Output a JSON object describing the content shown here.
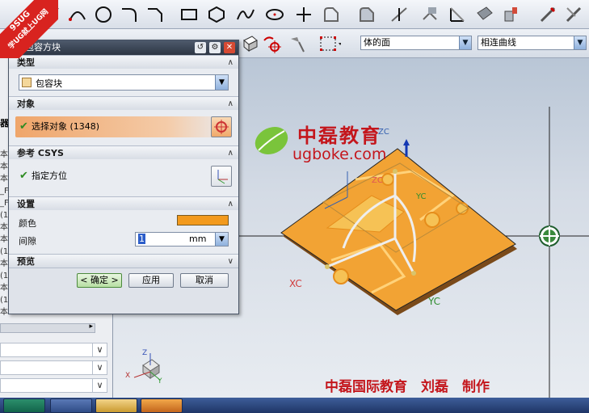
{
  "corner_badge": {
    "line1": "9SUG",
    "line2": "学UG就上UG网"
  },
  "toolbar2": {
    "combo1_value": "体的面",
    "combo2_value": "相连曲线"
  },
  "dialog": {
    "title": "包容方块",
    "sections": {
      "type": {
        "header": "类型",
        "value": "包容块"
      },
      "object": {
        "header": "对象",
        "select_label": "选择对象 (1348)"
      },
      "csys": {
        "header": "参考 CSYS",
        "orient_label": "指定方位"
      },
      "settings": {
        "header": "设置",
        "color_label": "颜色",
        "gap_label": "间隙",
        "gap_value": "1",
        "gap_unit": "mm"
      },
      "preview": {
        "header": "预览"
      }
    },
    "buttons": {
      "ok": "< 确定 >",
      "apply": "应用",
      "cancel": "取消"
    },
    "colors": {
      "swatch": "#f39a1d"
    }
  },
  "left_panel": {
    "header": "器",
    "rows": [
      "本",
      "本",
      "本",
      "_F_",
      "_F_",
      "(1)",
      "本",
      "本",
      "(1)",
      "本",
      "(1)",
      "本",
      "(1)",
      "本"
    ]
  },
  "viewport": {
    "brand_cn": "中磊教育",
    "brand_url": "ugboke.com",
    "credit": "中磊国际教育　刘磊　制作",
    "axis_labels": {
      "xc": "XC",
      "yc_small": "YC",
      "yc": "YC",
      "zc": "ZC",
      "zc_small": "ZC"
    },
    "triad": {
      "x": "X",
      "y": "Y",
      "z": "Z"
    }
  }
}
